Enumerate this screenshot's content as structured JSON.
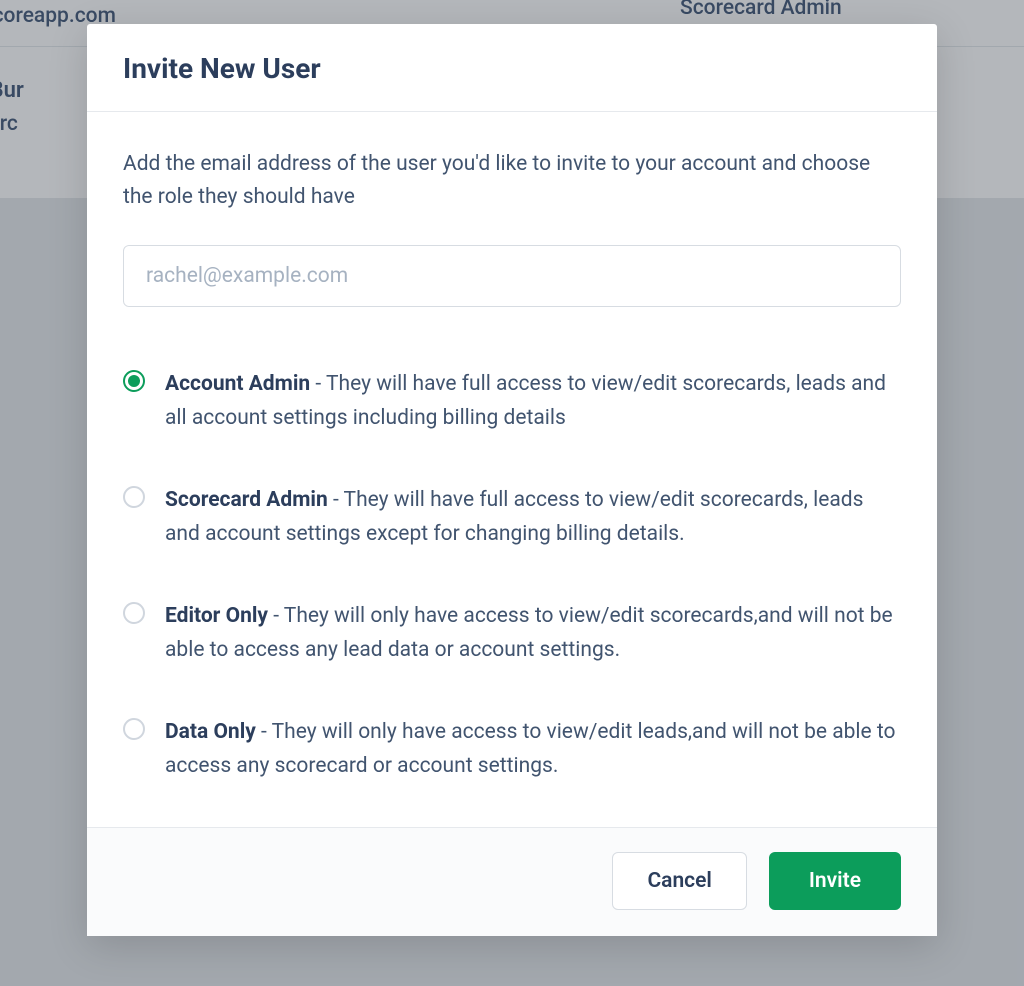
{
  "background": {
    "row1": {
      "email": "en@scoreapp.com",
      "role": "Scorecard Admin"
    },
    "row2": {
      "name": "hard Bur",
      "email": "ard.burc"
    }
  },
  "modal": {
    "title": "Invite New User",
    "instruction": "Add the email address of the user you'd like to invite to your account and choose the role they should have",
    "email_placeholder": "rachel@example.com",
    "roles": [
      {
        "name": "Account Admin",
        "description": " - They will have full access to view/edit scorecards, leads and all account settings including billing details",
        "checked": true
      },
      {
        "name": "Scorecard Admin",
        "description": " - They will have full access to view/edit scorecards, leads and account settings except for changing billing details.",
        "checked": false
      },
      {
        "name": "Editor Only",
        "description": " - They will only have access to view/edit scorecards,and will not be able to access any lead data or account settings.",
        "checked": false
      },
      {
        "name": "Data Only",
        "description": " - They will only have access to view/edit leads,and will not be able to access any scorecard or account settings.",
        "checked": false
      }
    ],
    "cancel_label": "Cancel",
    "invite_label": "Invite"
  }
}
